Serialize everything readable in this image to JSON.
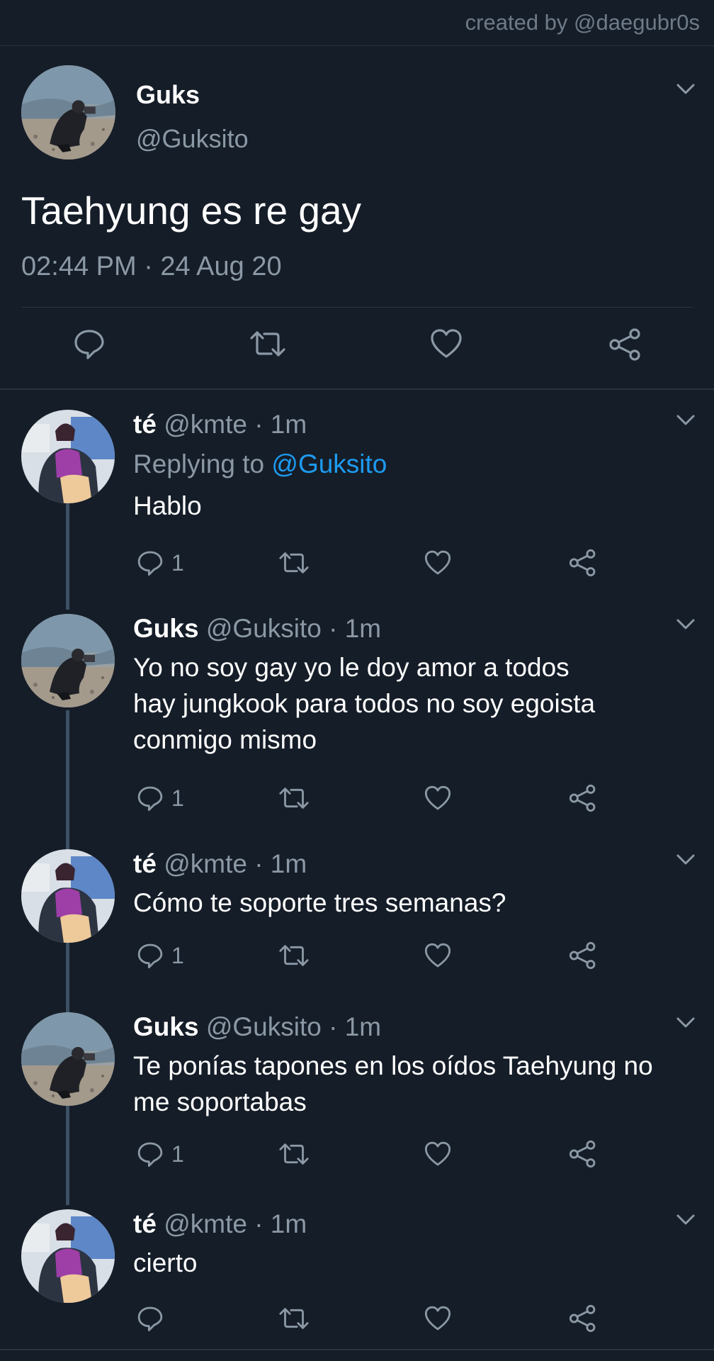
{
  "credit": "created by @daegubr0s",
  "colors": {
    "background": "#151d28",
    "text": "#ffffff",
    "muted": "#8b98a5",
    "link": "#1d9bf0",
    "thread": "#3c5164"
  },
  "main_tweet": {
    "name": "Guks",
    "handle": "@Guksito",
    "text": "Taehyung es re gay",
    "timestamp": "02:44 PM · 24 Aug 20",
    "avatar": "avatar-guks",
    "actions": [
      "reply-icon",
      "retweet-icon",
      "like-icon",
      "share-icon"
    ]
  },
  "replies": [
    {
      "name": "té",
      "handle_time": "@kmte · 1m",
      "replying_label": "Replying to",
      "replying_to": "@Guksito",
      "text": "Hablo",
      "reply_count": "1",
      "avatar": "avatar-te"
    },
    {
      "name": "Guks",
      "handle_time": "@Guksito · 1m",
      "text_lines": [
        "Yo no soy gay yo le doy amor a todos",
        "hay jungkook para todos no soy egoista",
        "conmigo mismo"
      ],
      "reply_count": "1",
      "avatar": "avatar-guks"
    },
    {
      "name": "té",
      "handle_time": "@kmte · 1m",
      "text": "Cómo te soporte tres semanas?",
      "reply_count": "1",
      "avatar": "avatar-te"
    },
    {
      "name": "Guks",
      "handle_time": "@Guksito · 1m",
      "text_lines": [
        "Te ponías tapones en los oídos Taehyung no",
        "me soportabas"
      ],
      "reply_count": "1",
      "avatar": "avatar-guks"
    },
    {
      "name": "té",
      "handle_time": "@kmte · 1m",
      "text": "cierto",
      "reply_count": "",
      "avatar": "avatar-te"
    }
  ]
}
